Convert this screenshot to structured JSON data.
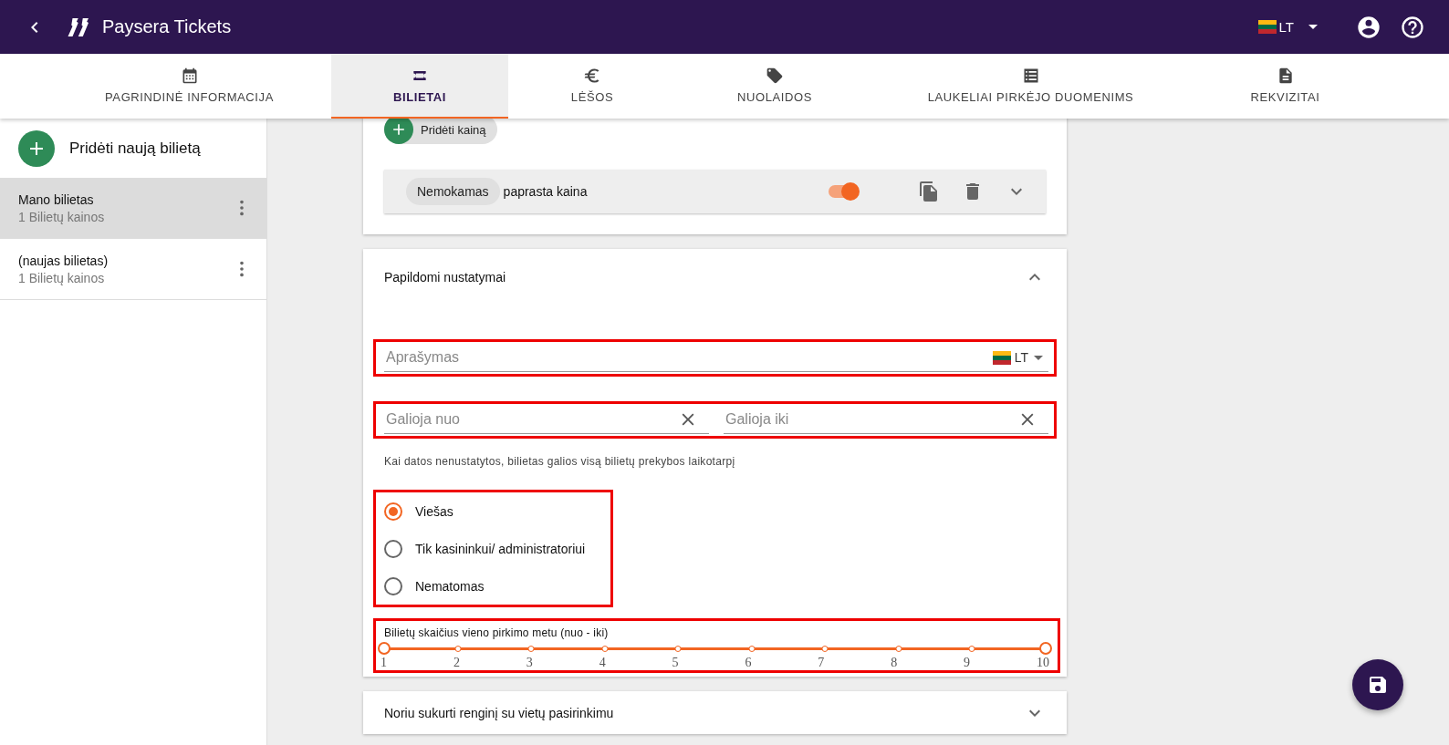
{
  "app_bar": {
    "title": "Paysera Tickets",
    "language": "LT"
  },
  "tabs": [
    {
      "label": "PAGRINDINĖ INFORMACIJA",
      "selected": false
    },
    {
      "label": "BILIETAI",
      "selected": true
    },
    {
      "label": "LĖŠOS",
      "selected": false
    },
    {
      "label": "NUOLAIDOS",
      "selected": false
    },
    {
      "label": "LAUKELIAI PIRKĖJO DUOMENIMS",
      "selected": false
    },
    {
      "label": "REKVIZITAI",
      "selected": false
    }
  ],
  "sidebar": {
    "add_label": "Pridėti naują bilietą",
    "items": [
      {
        "title": "Mano bilietas",
        "subtitle": "1 Bilietų kainos",
        "selected": true
      },
      {
        "title": "(naujas bilietas)",
        "subtitle": "1 Bilietų kainos",
        "selected": false
      }
    ]
  },
  "prices_card": {
    "add_price_label": "Pridėti kainą",
    "price": {
      "chip": "Nemokamas",
      "name": "paprasta kaina",
      "enabled": true
    }
  },
  "additional_settings": {
    "title": "Papildomi nustatymai",
    "expanded": true,
    "description_field": {
      "placeholder": "Aprašymas",
      "language": "LT"
    },
    "valid_from": {
      "placeholder": "Galioja nuo"
    },
    "valid_to": {
      "placeholder": "Galioja iki"
    },
    "dates_hint": "Kai datos nenustatytos, bilietas galios visą bilietų prekybos laikotarpį",
    "visibility": [
      {
        "label": "Viešas",
        "selected": true
      },
      {
        "label": "Tik kasininkui/ administratoriui",
        "selected": false
      },
      {
        "label": "Nematomas",
        "selected": false
      }
    ],
    "quantity_slider": {
      "label": "Bilietų skaičius vieno pirkimo metu (nuo - iki)",
      "ticks": [
        "1",
        "2",
        "3",
        "4",
        "5",
        "6",
        "7",
        "8",
        "9",
        "10"
      ],
      "handles": [
        {
          "level": 0
        },
        {
          "level": 1
        }
      ]
    }
  },
  "seating_section": {
    "title": "Noriu sukurti renginį su vietų pasirinkimu",
    "expanded": false
  }
}
